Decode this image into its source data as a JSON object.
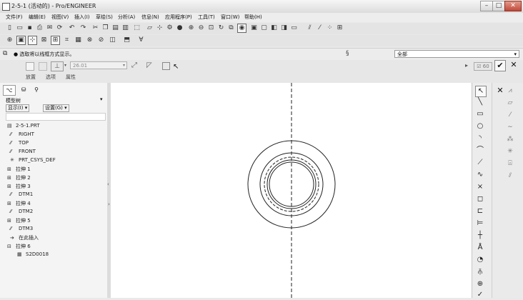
{
  "window": {
    "title": "2-5-1 (活动的) - Pro/ENGINEER",
    "minimize": "–",
    "maximize": "□",
    "close": "✕"
  },
  "menubar": {
    "items": [
      "文件(F)",
      "编辑(E)",
      "视图(V)",
      "插入(I)",
      "草绘(S)",
      "分析(A)",
      "信息(N)",
      "应用程序(P)",
      "工具(T)",
      "窗口(W)",
      "帮助(H)"
    ]
  },
  "message_bar": {
    "message": "● 选取将以线框方式显示。",
    "filter_value": "全部"
  },
  "dashboard": {
    "depth_value": "26.01",
    "tabs": [
      "放置",
      "选项",
      "属性"
    ]
  },
  "model_tree": {
    "header": "模型树",
    "show_button": "显示(I) ▾",
    "settings_button": "设置(G) ▾",
    "items": [
      {
        "label": "2-5-1.PRT",
        "icon": "part-icon"
      },
      {
        "label": "RIGHT",
        "icon": "datum-plane-icon"
      },
      {
        "label": "TOP",
        "icon": "datum-plane-icon"
      },
      {
        "label": "FRONT",
        "icon": "datum-plane-icon"
      },
      {
        "label": "PRT_CSYS_DEF",
        "icon": "csys-icon"
      },
      {
        "label": "拉伸 1",
        "icon": "extrude-icon"
      },
      {
        "label": "拉伸 2",
        "icon": "extrude-icon"
      },
      {
        "label": "拉伸 3",
        "icon": "extrude-icon"
      },
      {
        "label": "DTM1",
        "icon": "datum-plane-icon"
      },
      {
        "label": "拉伸 4",
        "icon": "extrude-icon"
      },
      {
        "label": "DTM2",
        "icon": "datum-plane-icon"
      },
      {
        "label": "拉伸 5",
        "icon": "extrude-icon"
      },
      {
        "label": "DTM3",
        "icon": "datum-plane-icon"
      },
      {
        "label": "在此插入",
        "icon": "insert-arrow-icon"
      },
      {
        "label": "拉伸 6",
        "icon": "extrude-icon"
      },
      {
        "label": "S2D0018",
        "icon": "sketch-icon"
      }
    ]
  }
}
